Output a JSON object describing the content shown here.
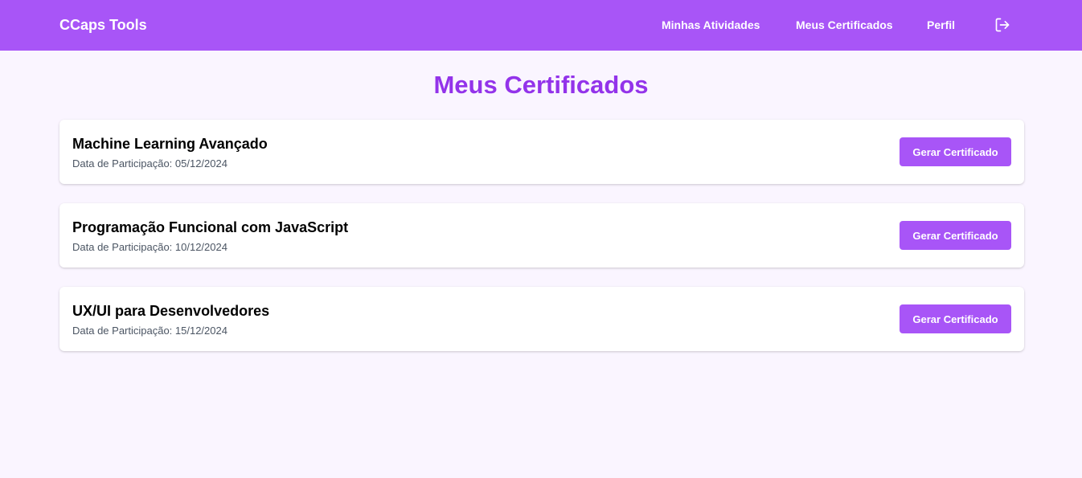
{
  "navbar": {
    "brand": "CCaps Tools",
    "links": [
      "Minhas Atividades",
      "Meus Certificados",
      "Perfil"
    ],
    "logout_icon": "logout-icon",
    "background": "#a855f7"
  },
  "page": {
    "title": "Meus Certificados",
    "title_color": "#9333ea",
    "background": "#faf5ff"
  },
  "certificates": [
    {
      "title": "Machine Learning Avançado",
      "date_label": "Data de Participação: 05/12/2024",
      "button_label": "Gerar Certificado"
    },
    {
      "title": "Programação Funcional com JavaScript",
      "date_label": "Data de Participação: 10/12/2024",
      "button_label": "Gerar Certificado"
    },
    {
      "title": "UX/UI para Desenvolvedores",
      "date_label": "Data de Participação: 15/12/2024",
      "button_label": "Gerar Certificado"
    }
  ]
}
